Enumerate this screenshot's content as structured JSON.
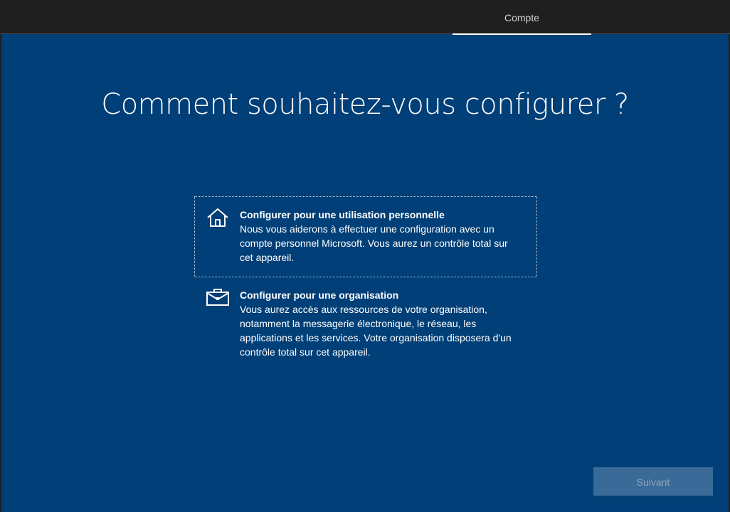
{
  "header": {
    "active_tab": "Compte"
  },
  "page": {
    "title": "Comment souhaitez-vous configurer ?"
  },
  "options": [
    {
      "icon": "home-icon",
      "title": "Configurer pour une utilisation personnelle",
      "description": "Nous vous aiderons à effectuer une configuration avec un compte personnel Microsoft. Vous aurez un contrôle total sur cet appareil.",
      "selected": true
    },
    {
      "icon": "briefcase-icon",
      "title": "Configurer pour une organisation",
      "description": "Vous aurez accès aux ressources de votre organisation, notamment la messagerie électronique, le réseau, les applications et les services. Votre organisation disposera d'un contrôle total sur cet appareil.",
      "selected": false
    }
  ],
  "footer": {
    "next_label": "Suivant",
    "next_enabled": false
  },
  "colors": {
    "background": "#003f77",
    "topbar": "#1f1f1f",
    "button_disabled": "#3a6a97"
  }
}
